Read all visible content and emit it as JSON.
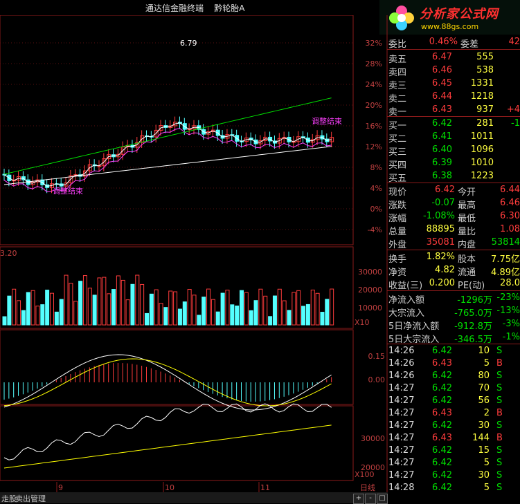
{
  "window": {
    "title": "通达信金融终端",
    "stock": "黔轮胎A"
  },
  "logo": {
    "text": "分析家公式网",
    "url": "www.88gs.com"
  },
  "price_axis": [
    "32%",
    "28%",
    "24%",
    "20%",
    "16%",
    "12%",
    "8%",
    "4%",
    "0%",
    "-4%"
  ],
  "volume_axis": [
    "30000",
    "20000",
    "10000"
  ],
  "volume_unit": "X10",
  "macd_axis": [
    "0.15",
    "0.00"
  ],
  "bottom_axis": [
    "30000",
    "20000"
  ],
  "bottom_unit": "X100",
  "period_button": "日线",
  "annotations": {
    "peak": "6.79",
    "adjust_end_1": "调整结束",
    "adjust_end_2": "调整结束",
    "vol_label": "3.20"
  },
  "date_labels": [
    "9",
    "10",
    "11"
  ],
  "bottom_tabs": [
    "走股",
    "卖出管理"
  ],
  "scroll_buttons": [
    "+",
    "-",
    "□"
  ],
  "quote": {
    "ratio": {
      "label": "委比",
      "value": "0.46%",
      "label2": "委差",
      "value2": "42"
    },
    "asks": [
      {
        "label": "卖五",
        "price": "6.47",
        "vol": "555"
      },
      {
        "label": "卖四",
        "price": "6.46",
        "vol": "538"
      },
      {
        "label": "卖三",
        "price": "6.45",
        "vol": "1331"
      },
      {
        "label": "卖二",
        "price": "6.44",
        "vol": "1218"
      },
      {
        "label": "卖一",
        "price": "6.43",
        "vol": "937",
        "chg": "+4"
      }
    ],
    "bids": [
      {
        "label": "买一",
        "price": "6.42",
        "vol": "281",
        "chg": "-1"
      },
      {
        "label": "买二",
        "price": "6.41",
        "vol": "1011"
      },
      {
        "label": "买三",
        "price": "6.40",
        "vol": "1096"
      },
      {
        "label": "买四",
        "price": "6.39",
        "vol": "1010"
      },
      {
        "label": "买五",
        "price": "6.38",
        "vol": "1223"
      }
    ],
    "stats": [
      {
        "l1": "现价",
        "v1": "6.42",
        "l2": "今开",
        "v2": "6.44"
      },
      {
        "l1": "涨跌",
        "v1": "-0.07",
        "l2": "最高",
        "v2": "6.46"
      },
      {
        "l1": "涨幅",
        "v1": "-1.08%",
        "l2": "最低",
        "v2": "6.30"
      },
      {
        "l1": "总量",
        "v1": "88895",
        "l2": "量比",
        "v2": "1.08"
      },
      {
        "l1": "外盘",
        "v1": "35081",
        "l2": "内盘",
        "v2": "53814"
      }
    ],
    "stats2": [
      {
        "l1": "换手",
        "v1": "1.82%",
        "l2": "股本",
        "v2": "7.75亿"
      },
      {
        "l1": "净资",
        "v1": "4.82",
        "l2": "流通",
        "v2": "4.89亿"
      },
      {
        "l1": "收益(三)",
        "v1": "0.200",
        "l2": "PE(动)",
        "v2": "28.0"
      }
    ],
    "flows": [
      {
        "label": "净流入额",
        "value": "-1296万",
        "pct": "-23%"
      },
      {
        "label": "大宗流入",
        "value": "-765.0万",
        "pct": "-13%"
      },
      {
        "label": "5日净流入额",
        "value": "-912.8万",
        "pct": "-3%"
      },
      {
        "label": "5日大宗流入",
        "value": "-346.5万",
        "pct": "-1%"
      }
    ],
    "ticks": [
      {
        "time": "14:26",
        "price": "6.42",
        "vol": "10",
        "side": "S"
      },
      {
        "time": "14:26",
        "price": "6.43",
        "vol": "5",
        "side": "B"
      },
      {
        "time": "14:26",
        "price": "6.42",
        "vol": "80",
        "side": "S"
      },
      {
        "time": "14:27",
        "price": "6.42",
        "vol": "70",
        "side": "S"
      },
      {
        "time": "14:27",
        "price": "6.42",
        "vol": "56",
        "side": "S"
      },
      {
        "time": "14:27",
        "price": "6.43",
        "vol": "2",
        "side": "B"
      },
      {
        "time": "14:27",
        "price": "6.42",
        "vol": "30",
        "side": "S"
      },
      {
        "time": "14:27",
        "price": "6.43",
        "vol": "144",
        "side": "B"
      },
      {
        "time": "14:27",
        "price": "6.42",
        "vol": "15",
        "side": "S"
      },
      {
        "time": "14:27",
        "price": "6.42",
        "vol": "5",
        "side": "S"
      },
      {
        "time": "14:27",
        "price": "6.42",
        "vol": "30",
        "side": "S"
      },
      {
        "time": "14:28",
        "price": "6.42",
        "vol": "5",
        "side": "S"
      }
    ]
  },
  "colors": {
    "up": "#ff3c3c",
    "down": "#54ffff",
    "grid": "#8b1a1a",
    "yellow": "#ffff00",
    "green": "#00e000",
    "white": "#ffffff",
    "magenta": "#ff40ff"
  }
}
